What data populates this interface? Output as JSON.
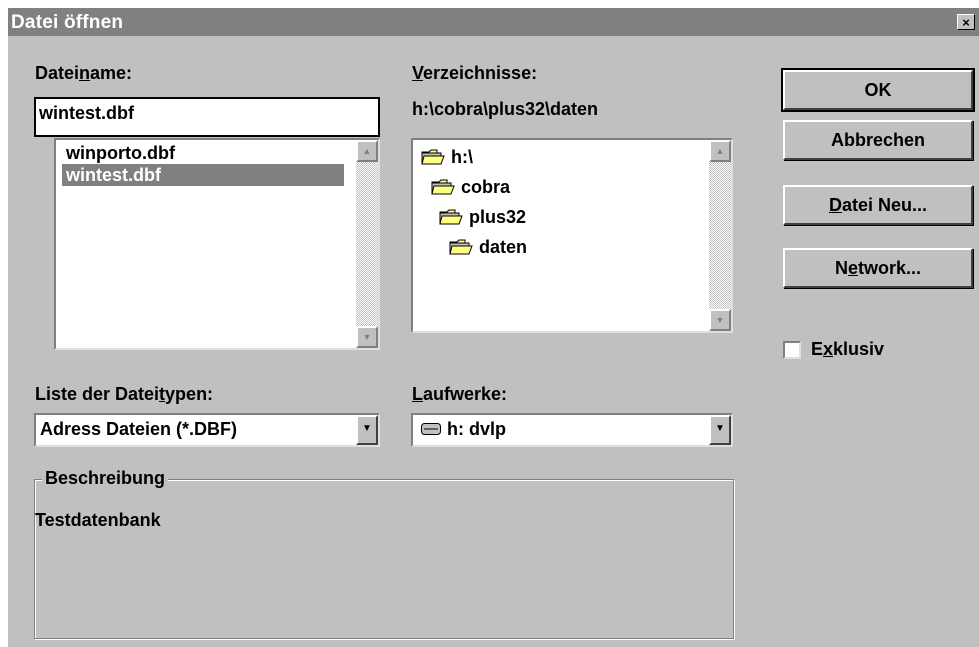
{
  "window": {
    "title": "Datei öffnen",
    "close_glyph": "×"
  },
  "filename": {
    "label_pre": "Datei",
    "label_u": "n",
    "label_post": "ame:",
    "value": "wintest.dbf",
    "files": [
      "winporto.dbf",
      "wintest.dbf"
    ],
    "selected_index": 1
  },
  "directories": {
    "label_u": "V",
    "label_post": "erzeichnisse:",
    "current_path": "h:\\cobra\\plus32\\daten",
    "tree": [
      "h:\\",
      "cobra",
      "plus32",
      "daten"
    ]
  },
  "filetypes": {
    "label_pre": "Liste der Datei",
    "label_u": "t",
    "label_post": "ypen:",
    "selected": "Adress Dateien (*.DBF)"
  },
  "drives": {
    "label_u": "L",
    "label_post": "aufwerke:",
    "selected": "h: dvlp"
  },
  "description": {
    "legend": "Beschreibung",
    "text": "Testdatenbank"
  },
  "buttons": {
    "ok": "OK",
    "cancel": "Abbrechen",
    "new_u": "D",
    "new_post": "atei Neu...",
    "network_pre": "N",
    "network_u": "e",
    "network_post": "twork..."
  },
  "exclusive": {
    "label_pre": "E",
    "label_u": "x",
    "label_post": "klusiv",
    "checked": false
  },
  "colors": {
    "face": "#c0c0c0",
    "titlebar": "#808080",
    "selection": "#808080",
    "folder": "#ffff80"
  }
}
